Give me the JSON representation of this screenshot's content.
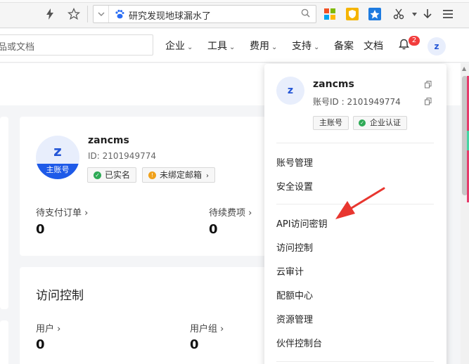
{
  "browser": {
    "search_text": "研究发现地球漏水了"
  },
  "header": {
    "search_placeholder": "品或文档",
    "nav": [
      {
        "label": "企业"
      },
      {
        "label": "工具"
      },
      {
        "label": "费用"
      },
      {
        "label": "支持"
      },
      {
        "label": "备案"
      },
      {
        "label": "文档"
      }
    ],
    "notification_count": "2",
    "avatar_letter": "z"
  },
  "account_card": {
    "avatar_letter": "z",
    "avatar_badge": "主账号",
    "username": "zancms",
    "user_id": "ID: 2101949774",
    "tags": [
      "已实名",
      "未绑定邮箱"
    ],
    "stats": [
      {
        "label": "待支付订单",
        "value": "0"
      },
      {
        "label": "待续费项",
        "value": "0"
      }
    ]
  },
  "access_card": {
    "title": "访问控制",
    "stats": [
      {
        "label": "用户",
        "value": "0"
      },
      {
        "label": "用户组",
        "value": "0"
      }
    ]
  },
  "dropdown": {
    "avatar_letter": "z",
    "username": "zancms",
    "account_id": "账号ID : 2101949774",
    "tags": [
      "主账号",
      "企业认证"
    ],
    "group1": [
      "账号管理",
      "安全设置"
    ],
    "group2": [
      "API访问密钥",
      "访问控制",
      "云审计",
      "配额中心",
      "资源管理",
      "伙伴控制台"
    ]
  },
  "colors": {
    "brand_blue": "#1e5ae8",
    "arrow_red": "#e8362f",
    "badge_red": "#f23d3d",
    "verified_green": "#2eaa56",
    "warning_orange": "#f0a11b"
  }
}
